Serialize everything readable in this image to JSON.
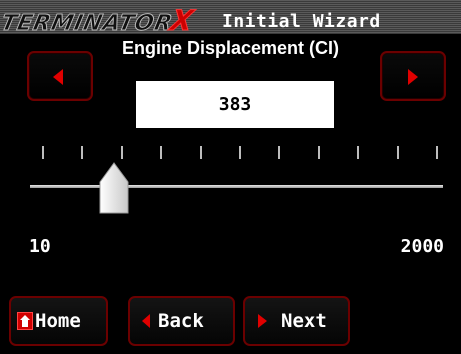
{
  "header": {
    "logo_text": "TERMINATOR",
    "logo_accent": "X",
    "title": "Initial Wizard"
  },
  "parameter": {
    "label": "Engine Displacement (CI)",
    "value": "383",
    "min_label": "10",
    "max_label": "2000",
    "min": 10,
    "max": 2000,
    "current": 383,
    "slider_fraction": 0.19
  },
  "controls": {
    "decrement_icon": "left-arrow-icon",
    "increment_icon": "right-arrow-icon"
  },
  "nav": {
    "home_label": "Home",
    "back_label": "Back",
    "next_label": "Next",
    "home_icon": "home-icon",
    "back_icon": "left-arrow-icon",
    "next_icon": "right-arrow-icon"
  },
  "colors": {
    "background": "#000000",
    "accent": "#e00000",
    "button_border": "#6b0000",
    "value_box": "#ffffff"
  },
  "tick_count": 11
}
